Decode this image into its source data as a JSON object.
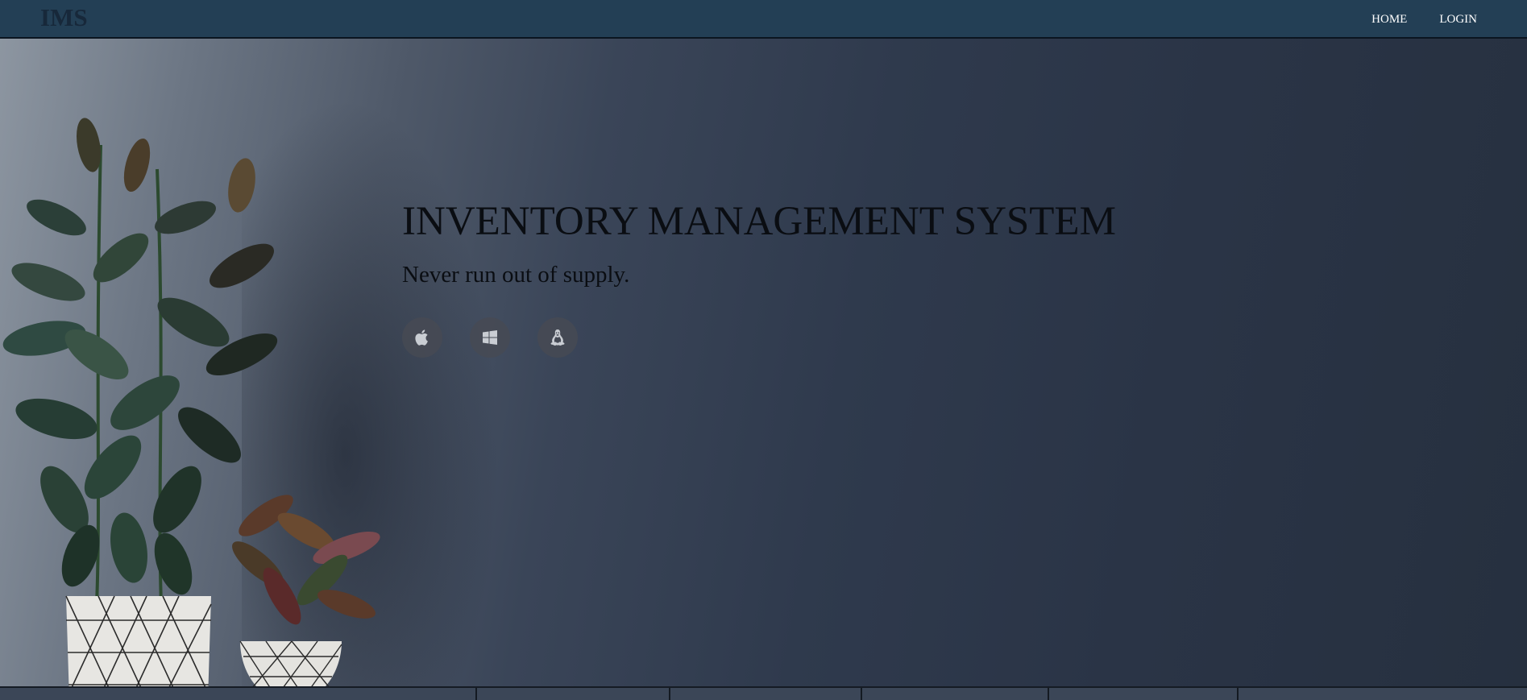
{
  "navbar": {
    "brand": "IMS",
    "links": [
      {
        "label": "HOME"
      },
      {
        "label": "LOGIN"
      }
    ]
  },
  "hero": {
    "title": "INVENTORY MANAGEMENT SYSTEM",
    "subtitle": "Never run out of supply."
  },
  "platform_icons": [
    "apple-icon",
    "windows-icon",
    "linux-icon"
  ],
  "colors": {
    "navbar": "#233f55",
    "brand": "#17283a",
    "nav_text": "#ffffff",
    "hero_text": "#0a0d12",
    "icon_circle": "#464a54",
    "wall": "#2f3a4d"
  }
}
